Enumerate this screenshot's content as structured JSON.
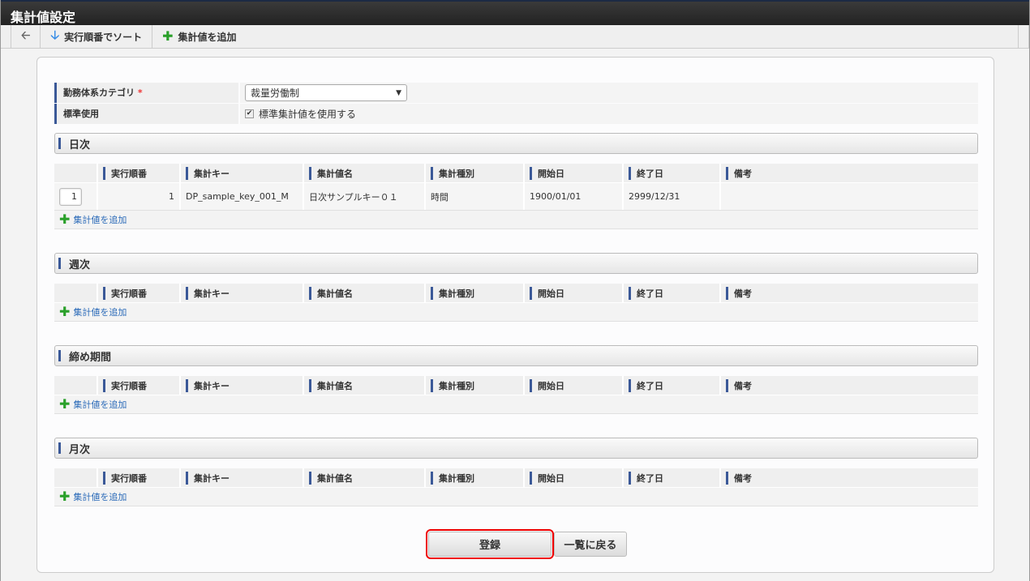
{
  "title": "集計値設定",
  "toolbar": {
    "sort": "実行順番でソート",
    "add": "集計値を追加"
  },
  "form": {
    "category_label": "勤務体系カテゴリ",
    "required": "*",
    "category_value": "裁量労働制",
    "standard_label": "標準使用",
    "standard_checkbox": "標準集計値を使用する",
    "standard_checked": true
  },
  "columns": [
    "実行順番",
    "集計キー",
    "集計値名",
    "集計種別",
    "開始日",
    "終了日",
    "備考"
  ],
  "add_label": "集計値を追加",
  "sections": [
    {
      "title": "日次",
      "rows": [
        {
          "input": "1",
          "order": "1",
          "key": "DP_sample_key_001_M",
          "name": "日次サンプルキー０１",
          "type": "時間",
          "start": "1900/01/01",
          "end": "2999/12/31",
          "note": ""
        }
      ]
    },
    {
      "title": "週次",
      "rows": []
    },
    {
      "title": "締め期間",
      "rows": []
    },
    {
      "title": "月次",
      "rows": []
    }
  ],
  "buttons": {
    "register": "登録",
    "back": "一覧に戻る"
  }
}
